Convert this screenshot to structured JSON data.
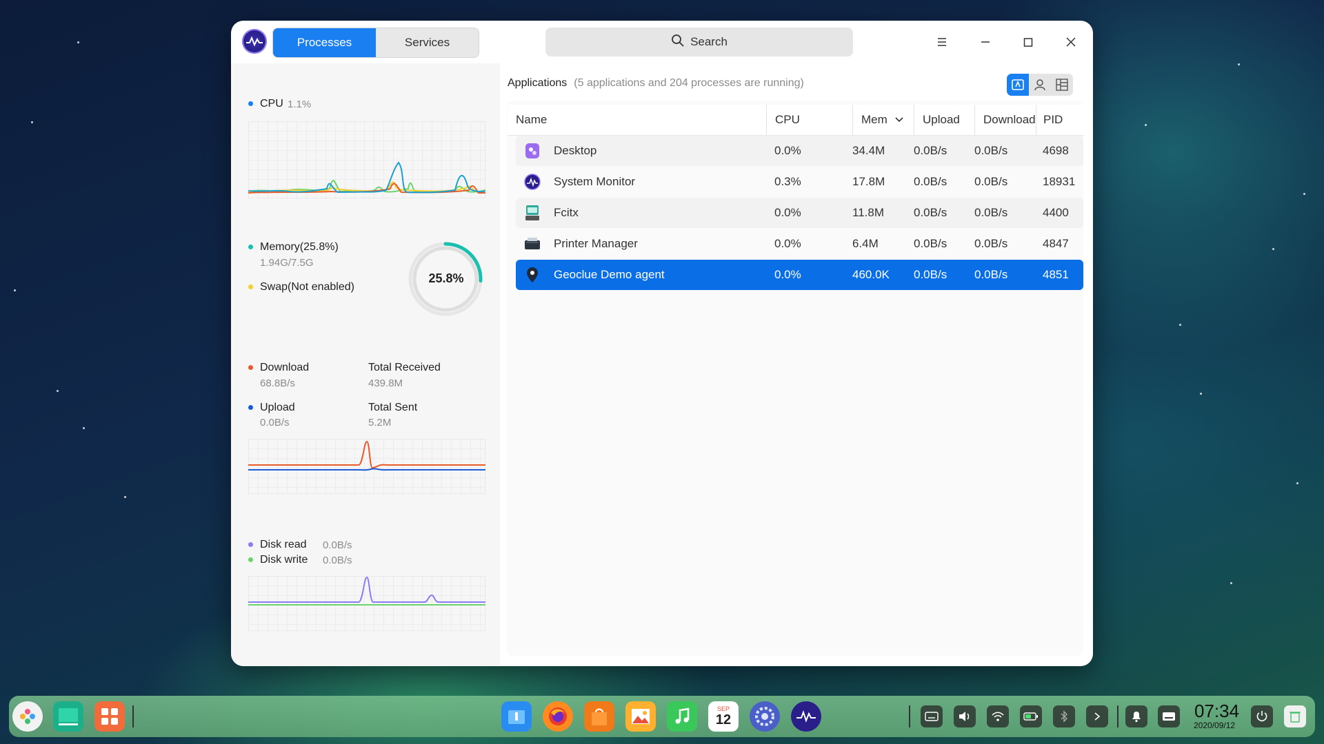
{
  "window": {
    "tabs": [
      {
        "label": "Processes",
        "active": true
      },
      {
        "label": "Services",
        "active": false
      }
    ],
    "search_placeholder": "Search"
  },
  "left": {
    "cpu": {
      "label": "CPU",
      "value": "1.1%"
    },
    "memory": {
      "label": "Memory(25.8%)",
      "used": "1.94G/7.5G",
      "ring_label": "25.8%",
      "percent": 25.8
    },
    "swap": {
      "label": "Swap(Not enabled)"
    },
    "network": {
      "download_label": "Download",
      "download_value": "68.8B/s",
      "total_received_label": "Total Received",
      "total_received_value": "439.8M",
      "upload_label": "Upload",
      "upload_value": "0.0B/s",
      "total_sent_label": "Total Sent",
      "total_sent_value": "5.2M"
    },
    "disk": {
      "read_label": "Disk read",
      "read_value": "0.0B/s",
      "write_label": "Disk write",
      "write_value": "0.0B/s"
    }
  },
  "main": {
    "heading": "Applications",
    "summary": "(5 applications and 204 processes are running)",
    "columns": [
      "Name",
      "CPU",
      "Mem",
      "Upload",
      "Download",
      "PID"
    ],
    "rows": [
      {
        "name": "Desktop",
        "cpu": "0.0%",
        "mem": "34.4M",
        "upload": "0.0B/s",
        "download": "0.0B/s",
        "pid": "4698",
        "icon": "desktop-icon"
      },
      {
        "name": "System Monitor",
        "cpu": "0.3%",
        "mem": "17.8M",
        "upload": "0.0B/s",
        "download": "0.0B/s",
        "pid": "18931",
        "icon": "system-monitor-icon"
      },
      {
        "name": "Fcitx",
        "cpu": "0.0%",
        "mem": "11.8M",
        "upload": "0.0B/s",
        "download": "0.0B/s",
        "pid": "4400",
        "icon": "keyboard-icon"
      },
      {
        "name": "Printer Manager",
        "cpu": "0.0%",
        "mem": "6.4M",
        "upload": "0.0B/s",
        "download": "0.0B/s",
        "pid": "4847",
        "icon": "printer-icon"
      },
      {
        "name": "Geoclue Demo agent",
        "cpu": "0.0%",
        "mem": "460.0K",
        "upload": "0.0B/s",
        "download": "0.0B/s",
        "pid": "4851",
        "icon": "location-pin-icon",
        "selected": true
      }
    ]
  },
  "taskbar": {
    "time": "07:34",
    "date": "2020/09/12",
    "calendar_day": "12",
    "calendar_month": "SEP"
  },
  "colors": {
    "accent": "#1a7ff0",
    "cpu": "#1a7ff0",
    "memory": "#1bbfb0",
    "swap": "#f2d12e",
    "download": "#e85a2a",
    "upload": "#1a5bd8",
    "disk_read": "#8a7cf5",
    "disk_write": "#6bd36b"
  }
}
